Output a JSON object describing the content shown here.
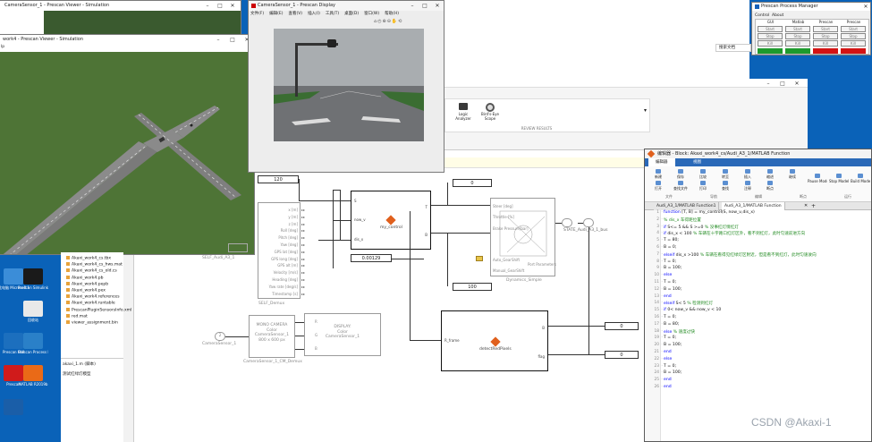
{
  "viewer_window": {
    "title": "work4 - Prescan Viewer - Simulation",
    "menu_label": "lp"
  },
  "viewer_back_window": {
    "title": "CameraSensor_1 - Prescan Viewer - Simulation"
  },
  "display_window": {
    "title": "CameraSensor_1 - Prescan Display",
    "menu": [
      "文件(F)",
      "编辑(E)",
      "查看(V)",
      "插入(I)",
      "工具(T)",
      "桌面(D)",
      "窗口(W)",
      "帮助(H)"
    ]
  },
  "process_manager": {
    "title": "Prescan Process Manager",
    "tabs": [
      "Control",
      "About"
    ],
    "columns": [
      "GUI",
      "Matlab",
      "Prescan",
      "Prescan"
    ],
    "rows": [
      [
        "Start",
        "Start",
        "Start",
        "Start"
      ],
      [
        "Stop",
        "Stop",
        "Stop",
        "Stop"
      ],
      [
        "Kill",
        "Kill",
        "Kill",
        "Kill"
      ]
    ],
    "status_colors": [
      "#1e9a2d",
      "#1e9a2d",
      "#d31313",
      "#d31313"
    ]
  },
  "review_toolbar": {
    "buttons": [
      {
        "label": "Logic\nAnalyzer",
        "icon": "logic-analyzer-icon"
      },
      {
        "label": "Bird's-Eye\nScope",
        "icon": "birds-eye-scope-icon"
      }
    ],
    "section": "REVIEW RESULTS",
    "search_hint": "搜索文档"
  },
  "desktop": {
    "icons": [
      {
        "label": "此电脑 Microsoft Edge",
        "color": "#3b8dd8"
      },
      {
        "label": "Prescan Simulink",
        "color": "#1a1a1a"
      },
      {
        "label": "回收站",
        "color": "#e9e9e9"
      },
      {
        "label": "Prescan GUI",
        "color": "#1c6fbe"
      },
      {
        "label": "Prescan Process Manager",
        "color": "#2a80c8"
      },
      {
        "label": "Prescan",
        "color": "#d01b1b"
      },
      {
        "label": "MATLAB R2019b",
        "color": "#ea6a17"
      }
    ]
  },
  "file_list": [
    "Akaxi_work4_cs.tbx",
    "Akaxi_work4_cs_hws.mat",
    "Akaxi_work4_cs_old.cs",
    "Akaxi_work4.pb",
    "Akaxi_work4.pepb",
    "Akaxi_work4.pex",
    "Akaxi_work4.references",
    "Akaxi_work4.runtable",
    "PrescanPluginSensorsInfo.xml",
    "red.mat",
    "viewer_assignment.bin"
  ],
  "details_panel": {
    "title": "akaxi_1.m  (脚本)",
    "text": "测试红绿灯模型"
  },
  "simulink": {
    "blocks": {
      "constant_value": "120",
      "display_top": "0",
      "display_mid": "0.00129",
      "display_bot": "100",
      "display_r1": "0",
      "display_r2": "0",
      "my_control_in": [
        "S",
        "now_v",
        "dis_x"
      ],
      "my_control_out": [
        "T",
        "B"
      ],
      "my_control_name": "my_control",
      "detect_name": "detectRedPixels",
      "detect_in": "R_frame",
      "detect_out": [
        "B",
        "flag"
      ],
      "self_ports": [
        "x [m]",
        "y [m]",
        "z [m]",
        "Roll [deg]",
        "Pitch [deg]",
        "Yaw [deg]",
        "GPS lat [deg]",
        "GPS long [deg]",
        "GPS alt [m]",
        "Velocity [m/s]",
        "Heading [deg]",
        "Yaw rate [deg/s]",
        "Timestamp [s]"
      ],
      "self_name": "SELF_Demux",
      "self_audi": "SELF_Audi_A3_1",
      "dyn_name": "Dynamics_Simple",
      "dyn_ports": [
        "Steer [deg]",
        "Throttle [%]",
        "Brake Pressure[bar]",
        "Auto_GearShift",
        "Manual_GearShift",
        "Port Parameters"
      ],
      "state_label": "STATE_Audi_A3_1_bus",
      "camera_const": "2",
      "camera_label": "CameraSensor_1",
      "mono_cam": [
        "MONO CAMERA",
        "Color",
        "CameraSensor_1",
        "800 x 600 px"
      ],
      "mono_cam_name": "CameraSensor_1_CM_Demux",
      "display_block": [
        "DISPLAY:",
        "Color",
        "CameraSensor_1"
      ],
      "rgb": [
        "R",
        "G",
        "B"
      ]
    }
  },
  "editor": {
    "title": "编辑器 - Block: Akaxi_work4_cs/Audi_A3_1/MATLAB Function",
    "ribbon_tabs": [
      "编辑器",
      "视图"
    ],
    "ribbon_groups": [
      "文件",
      "导航",
      "编辑",
      "断点",
      "运行"
    ],
    "ribbon_buttons": [
      "新建",
      "打开",
      "保存",
      "查找文件",
      "比较",
      "打印",
      "转至",
      "查找",
      "插入",
      "注释",
      "缩进",
      "断点",
      "继续",
      "Pause Model",
      "Stop Model",
      "Build Model"
    ],
    "ribbon_buttons_en": [
      "Pause Model",
      "Stop Model",
      "Build Model"
    ],
    "tabs": [
      "Audi_A3_1/MATLAB Function1",
      "Audi_A3_1/MATLAB Function"
    ],
    "lines": [
      {
        "n": "1",
        "t": "function [T, B] = my_control(S, now_v,dis_x)",
        "k": "k"
      },
      {
        "n": "2",
        "t": "    % dis_x 车得距位置",
        "k": "c"
      },
      {
        "n": "3",
        "t": "    if S<= 5 && S >=0 % 没事红灯情红灯",
        "k": "k"
      },
      {
        "n": "4",
        "t": "        if dis_x < 100 % 车辆在十字路口红灯区外，看不到红灯，此时匀速前进方向",
        "k": "k"
      },
      {
        "n": "5",
        "t": "            T = 80;",
        "k": "n"
      },
      {
        "n": "6",
        "t": "            B = 0;",
        "k": "n"
      },
      {
        "n": "7",
        "t": "        elseif dis_x >100 % 车辆在看得见红绿灯区附近，但是看不到红灯，此时匀速驶向",
        "k": "k"
      },
      {
        "n": "8",
        "t": "            T = 0;",
        "k": "n"
      },
      {
        "n": "9",
        "t": "            B = 100;",
        "k": "n"
      },
      {
        "n": "10",
        "t": "        else",
        "k": "k"
      },
      {
        "n": "11",
        "t": "            T = 0;",
        "k": "n"
      },
      {
        "n": "12",
        "t": "            B = 100;",
        "k": "n"
      },
      {
        "n": "13",
        "t": "        end",
        "k": "k"
      },
      {
        "n": "14",
        "t": "    elseif S< 5 % 检测到红灯",
        "k": "k"
      },
      {
        "n": "15",
        "t": "        if 0< now_v && now_v < 10",
        "k": "k"
      },
      {
        "n": "16",
        "t": "            T = 0;",
        "k": "n"
      },
      {
        "n": "17",
        "t": "            B = 80;",
        "k": "n"
      },
      {
        "n": "18",
        "t": "        else % 速度过快",
        "k": "k"
      },
      {
        "n": "19",
        "t": "            T = 0;",
        "k": "n"
      },
      {
        "n": "20",
        "t": "            B = 100;",
        "k": "n"
      },
      {
        "n": "21",
        "t": "        end",
        "k": "k"
      },
      {
        "n": "22",
        "t": "    else",
        "k": "k"
      },
      {
        "n": "23",
        "t": "        T = 0;",
        "k": "n"
      },
      {
        "n": "24",
        "t": "        B = 100;",
        "k": "n"
      },
      {
        "n": "25",
        "t": "    end",
        "k": "k"
      },
      {
        "n": "26",
        "t": "end",
        "k": "k"
      }
    ]
  },
  "watermark": "CSDN @Akaxi-1"
}
